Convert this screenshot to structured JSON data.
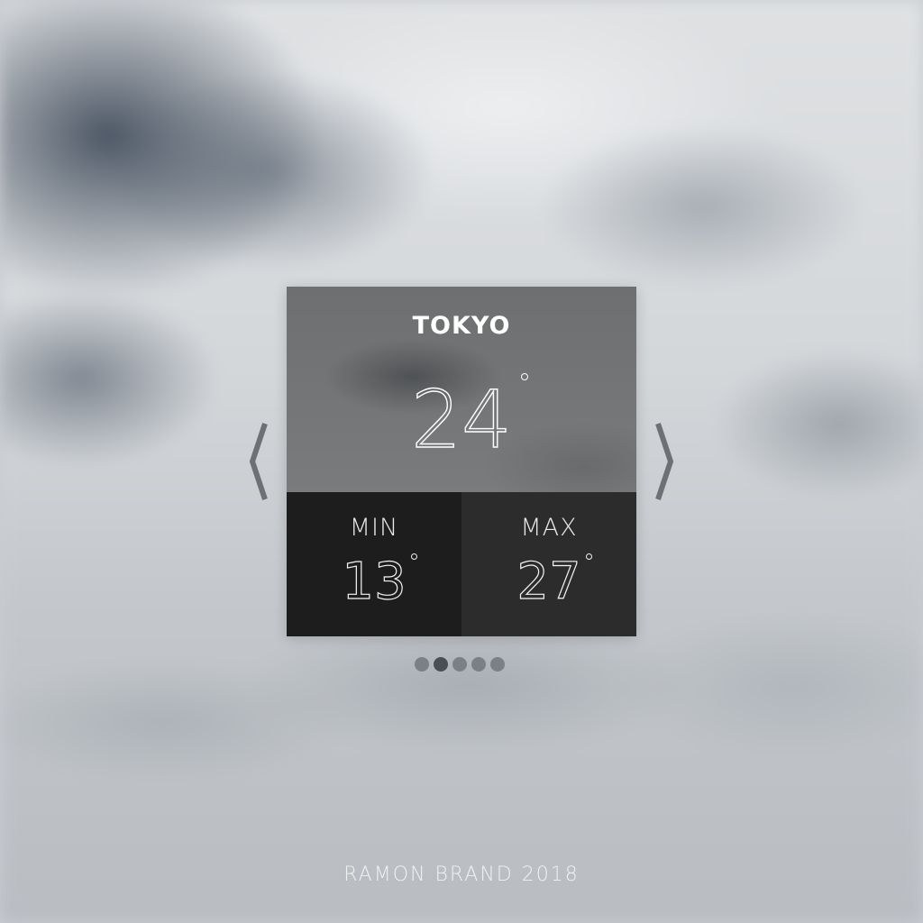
{
  "weather": {
    "city": "TOKYO",
    "current_temp": "24",
    "min_label": "MIN",
    "min_temp": "13",
    "max_label": "MAX",
    "max_temp": "27"
  },
  "navigation": {
    "prev_icon": "chevron-left-icon",
    "next_icon": "chevron-right-icon"
  },
  "pagination": {
    "count": 5,
    "active_index": 1
  },
  "footer": {
    "text": "RAMON BRAND 2018"
  },
  "colors": {
    "card_top": "#747576",
    "min_panel": "#1d1d1d",
    "max_panel": "#2c2c2c",
    "dot": "#7c7f83",
    "dot_active": "#4a4d51",
    "arrow": "#6e7073"
  }
}
